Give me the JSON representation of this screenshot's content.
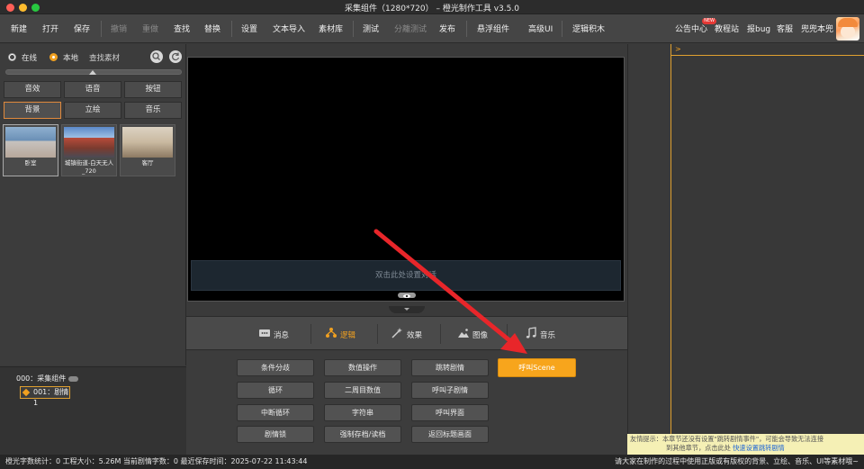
{
  "window": {
    "title": "采集组件（1280*720） – 橙光制作工具 v3.5.0"
  },
  "toolbar": {
    "items": [
      "新建",
      "打开",
      "保存",
      "撤销",
      "重做",
      "查找",
      "替换",
      "设置",
      "文本导入",
      "素材库",
      "测试",
      "分離测试",
      "发布",
      "悬浮组件",
      "高级UI",
      "逻辑积木"
    ],
    "right_items": [
      "公告中心",
      "教程站",
      "报bug",
      "客服",
      "兜兜本兜"
    ],
    "new_badge": "NEW"
  },
  "left_panel": {
    "online_label": "在线",
    "local_label": "本地",
    "search_label": "查找素材",
    "categories": [
      "音效",
      "语音",
      "按钮",
      "背景",
      "立绘",
      "音乐"
    ],
    "thumbnails": [
      {
        "caption": "卧室"
      },
      {
        "caption": "城镇街道-白天无人_720"
      },
      {
        "caption": "客厅"
      }
    ]
  },
  "layers": {
    "root_label": "000：采集组件",
    "child_label": "001：剧情1"
  },
  "stage": {
    "dialog_hint": "双击此处设置对话"
  },
  "tabs": [
    "消息",
    "逻辑",
    "效果",
    "图像",
    "音乐"
  ],
  "commands": {
    "col1": [
      "条件分歧",
      "循环",
      "中断循环",
      "剧情锁"
    ],
    "col2": [
      "数值操作",
      "二周目数值",
      "字符串",
      "强制存档/读档"
    ],
    "col3": [
      "跳转剧情",
      "呼叫子剧情",
      "呼叫界面",
      "返回标题画面"
    ],
    "col4": [
      "呼叫Scene"
    ]
  },
  "console": {
    "prompt": ">"
  },
  "tip": {
    "line1": "友情提示：本章节还没有设置\"跳转剧情事件\"，可能会导致无法连接",
    "line2": "到其他章节，点击此处",
    "link": "快速设置跳转剧情"
  },
  "statusbar": {
    "left": "橙光字数统计：0 工程大小：5.26M 当前剧情字数：0 最近保存时间：2025-07-22 11:43:44",
    "right": "请大家在制作的过程中使用正版或有版权的背景、立绘、音乐、UI等素材哦~"
  },
  "colors": {
    "accent": "#f7a51c",
    "annotation_arrow": "#e8262a"
  }
}
